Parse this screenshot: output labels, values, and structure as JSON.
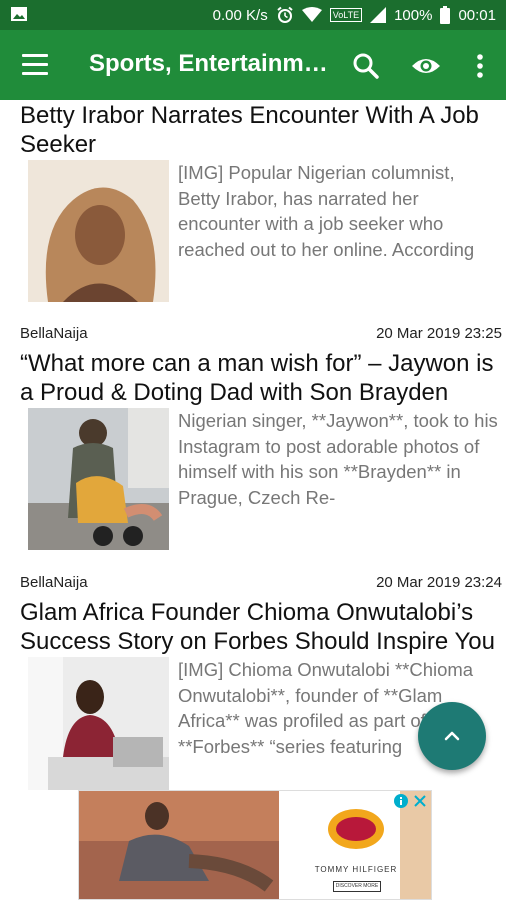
{
  "status": {
    "speed": "0.00 K/s",
    "network_badge": "VoLTE",
    "battery": "100%",
    "time": "00:01"
  },
  "appbar": {
    "title": "Sports, Entertainment"
  },
  "articles": [
    {
      "source": "",
      "date": "",
      "headline": "Betty Irabor Narrates Encounter With A Job Seeker",
      "excerpt": "[IMG] Popular Nigerian columnist, Betty Irabor, has narrated her encounter with a job seeker who reached out to her online. According"
    },
    {
      "source": "BellaNaija",
      "date": "20 Mar 2019 23:25",
      "headline": "“What more can a man wish for” – Jaywon is a Proud & Doting Dad with Son Brayden",
      "excerpt": "Nigerian singer, **Jaywon**, took to his Instagram to post adorable photos of himself with his son **Brayden** in Prague, Czech Re-"
    },
    {
      "source": "BellaNaija",
      "date": "20 Mar 2019 23:24",
      "headline": "Glam Africa Founder Chioma Onwutalobi’s Success Story on Forbes Should Inspire You",
      "excerpt": "[IMG] Chioma Onwutalobi **Chioma Onwutalobi**, founder of **Glam Africa** was profiled as part of **Forbes** “series featuring"
    }
  ],
  "ad": {
    "brand": "TOMMY HILFIGER",
    "cta": "DISCOVER MORE"
  },
  "colors": {
    "statusbar": "#1b6e2e",
    "appbar": "#208c3a",
    "fab": "#1e7a74",
    "excerpt_text": "#777777"
  },
  "icons": [
    "menu-icon",
    "search-icon",
    "eye-icon",
    "more-vert-icon",
    "chevron-up-icon",
    "ad-info-icon",
    "ad-close-icon",
    "image-icon",
    "alarm-icon",
    "wifi-icon",
    "signal-icon",
    "battery-icon"
  ]
}
